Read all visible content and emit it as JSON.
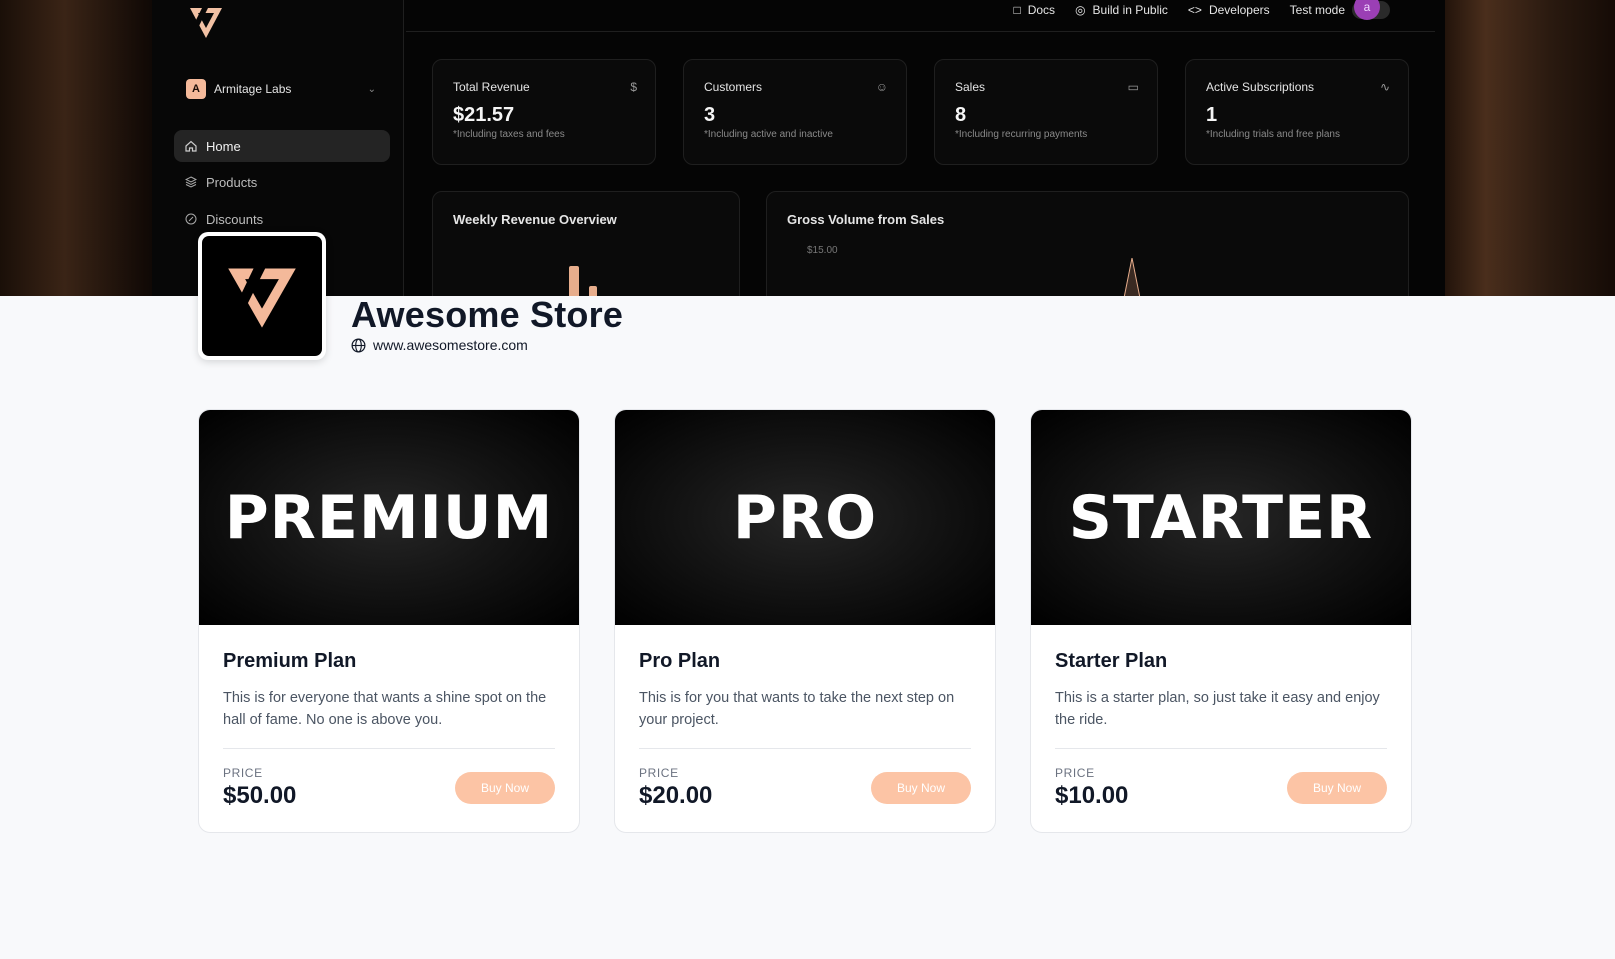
{
  "dashboard": {
    "org": {
      "initial": "A",
      "name": "Armitage Labs"
    },
    "nav": [
      {
        "label": "Home",
        "icon": "home-icon"
      },
      {
        "label": "Products",
        "icon": "layers-icon"
      },
      {
        "label": "Discounts",
        "icon": "percent-icon"
      }
    ],
    "topnav": {
      "docs": "Docs",
      "build": "Build in Public",
      "developers": "Developers",
      "test_mode": "Test mode",
      "avatar": "a"
    },
    "stats": [
      {
        "label": "Total Revenue",
        "value": "$21.57",
        "sub": "*Including taxes and fees",
        "icon": "dollar-icon"
      },
      {
        "label": "Customers",
        "value": "3",
        "sub": "*Including active and inactive",
        "icon": "users-icon"
      },
      {
        "label": "Sales",
        "value": "8",
        "sub": "*Including recurring payments",
        "icon": "card-icon"
      },
      {
        "label": "Active Subscriptions",
        "value": "1",
        "sub": "*Including trials and free plans",
        "icon": "activity-icon"
      }
    ],
    "panels": {
      "weekly": "Weekly Revenue Overview",
      "gross": "Gross Volume from Sales",
      "gross_axis": "$15.00"
    }
  },
  "store": {
    "name": "Awesome Store",
    "url": "www.awesomestore.com"
  },
  "products": [
    {
      "banner": "PREMIUM",
      "title": "Premium Plan",
      "description": "This is for everyone that wants a shine spot on the hall of fame. No one is above you.",
      "price_label": "PRICE",
      "price": "$50.00",
      "cta": "Buy Now"
    },
    {
      "banner": "PRO",
      "title": "Pro Plan",
      "description": "This is for you that wants to take the next step on your project.",
      "price_label": "PRICE",
      "price": "$20.00",
      "cta": "Buy Now"
    },
    {
      "banner": "STARTER",
      "title": "Starter Plan",
      "description": "This is a starter plan, so just take it easy and enjoy the ride.",
      "price_label": "PRICE",
      "price": "$10.00",
      "cta": "Buy Now"
    }
  ],
  "colors": {
    "accent": "#fcc4a5",
    "logo_peach": "#f4b99a",
    "text": "#111827",
    "muted": "#4b5563",
    "background": "#f8f9fb"
  }
}
